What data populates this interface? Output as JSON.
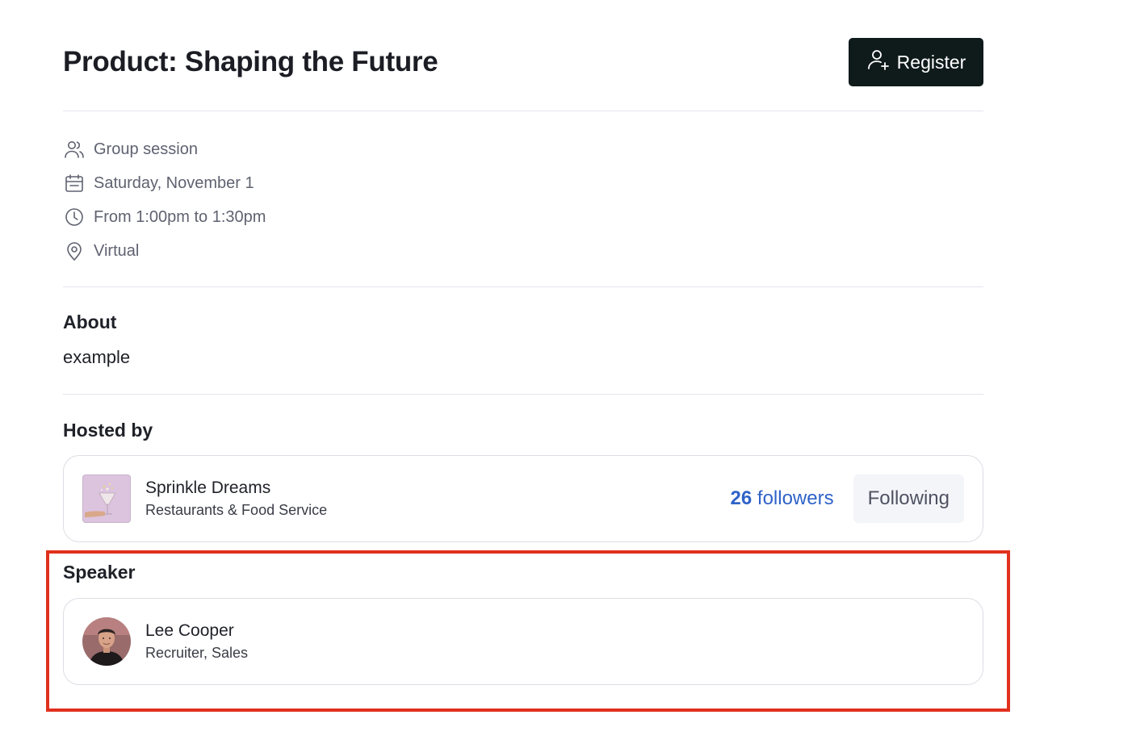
{
  "header": {
    "title": "Product: Shaping the Future",
    "register_label": "Register",
    "register_icon": "user-plus-icon",
    "register_bg": "#0f1a1b"
  },
  "details": [
    {
      "icon": "users-icon",
      "text": "Group session"
    },
    {
      "icon": "calendar-icon",
      "text": "Saturday, November 1"
    },
    {
      "icon": "clock-icon",
      "text": "From 1:00pm to 1:30pm"
    },
    {
      "icon": "map-pin-icon",
      "text": "Virtual"
    }
  ],
  "about": {
    "heading": "About",
    "text": "example"
  },
  "hosted_by": {
    "heading": "Hosted by",
    "name": "Sprinkle Dreams",
    "category": "Restaurants & Food Service",
    "followers_count": "26",
    "followers_label": "followers",
    "following_label": "Following",
    "link_color": "#2f63c8"
  },
  "speaker": {
    "heading": "Speaker",
    "name": "Lee Cooper",
    "role": "Recruiter, Sales"
  },
  "highlight_color": "#e0301e"
}
